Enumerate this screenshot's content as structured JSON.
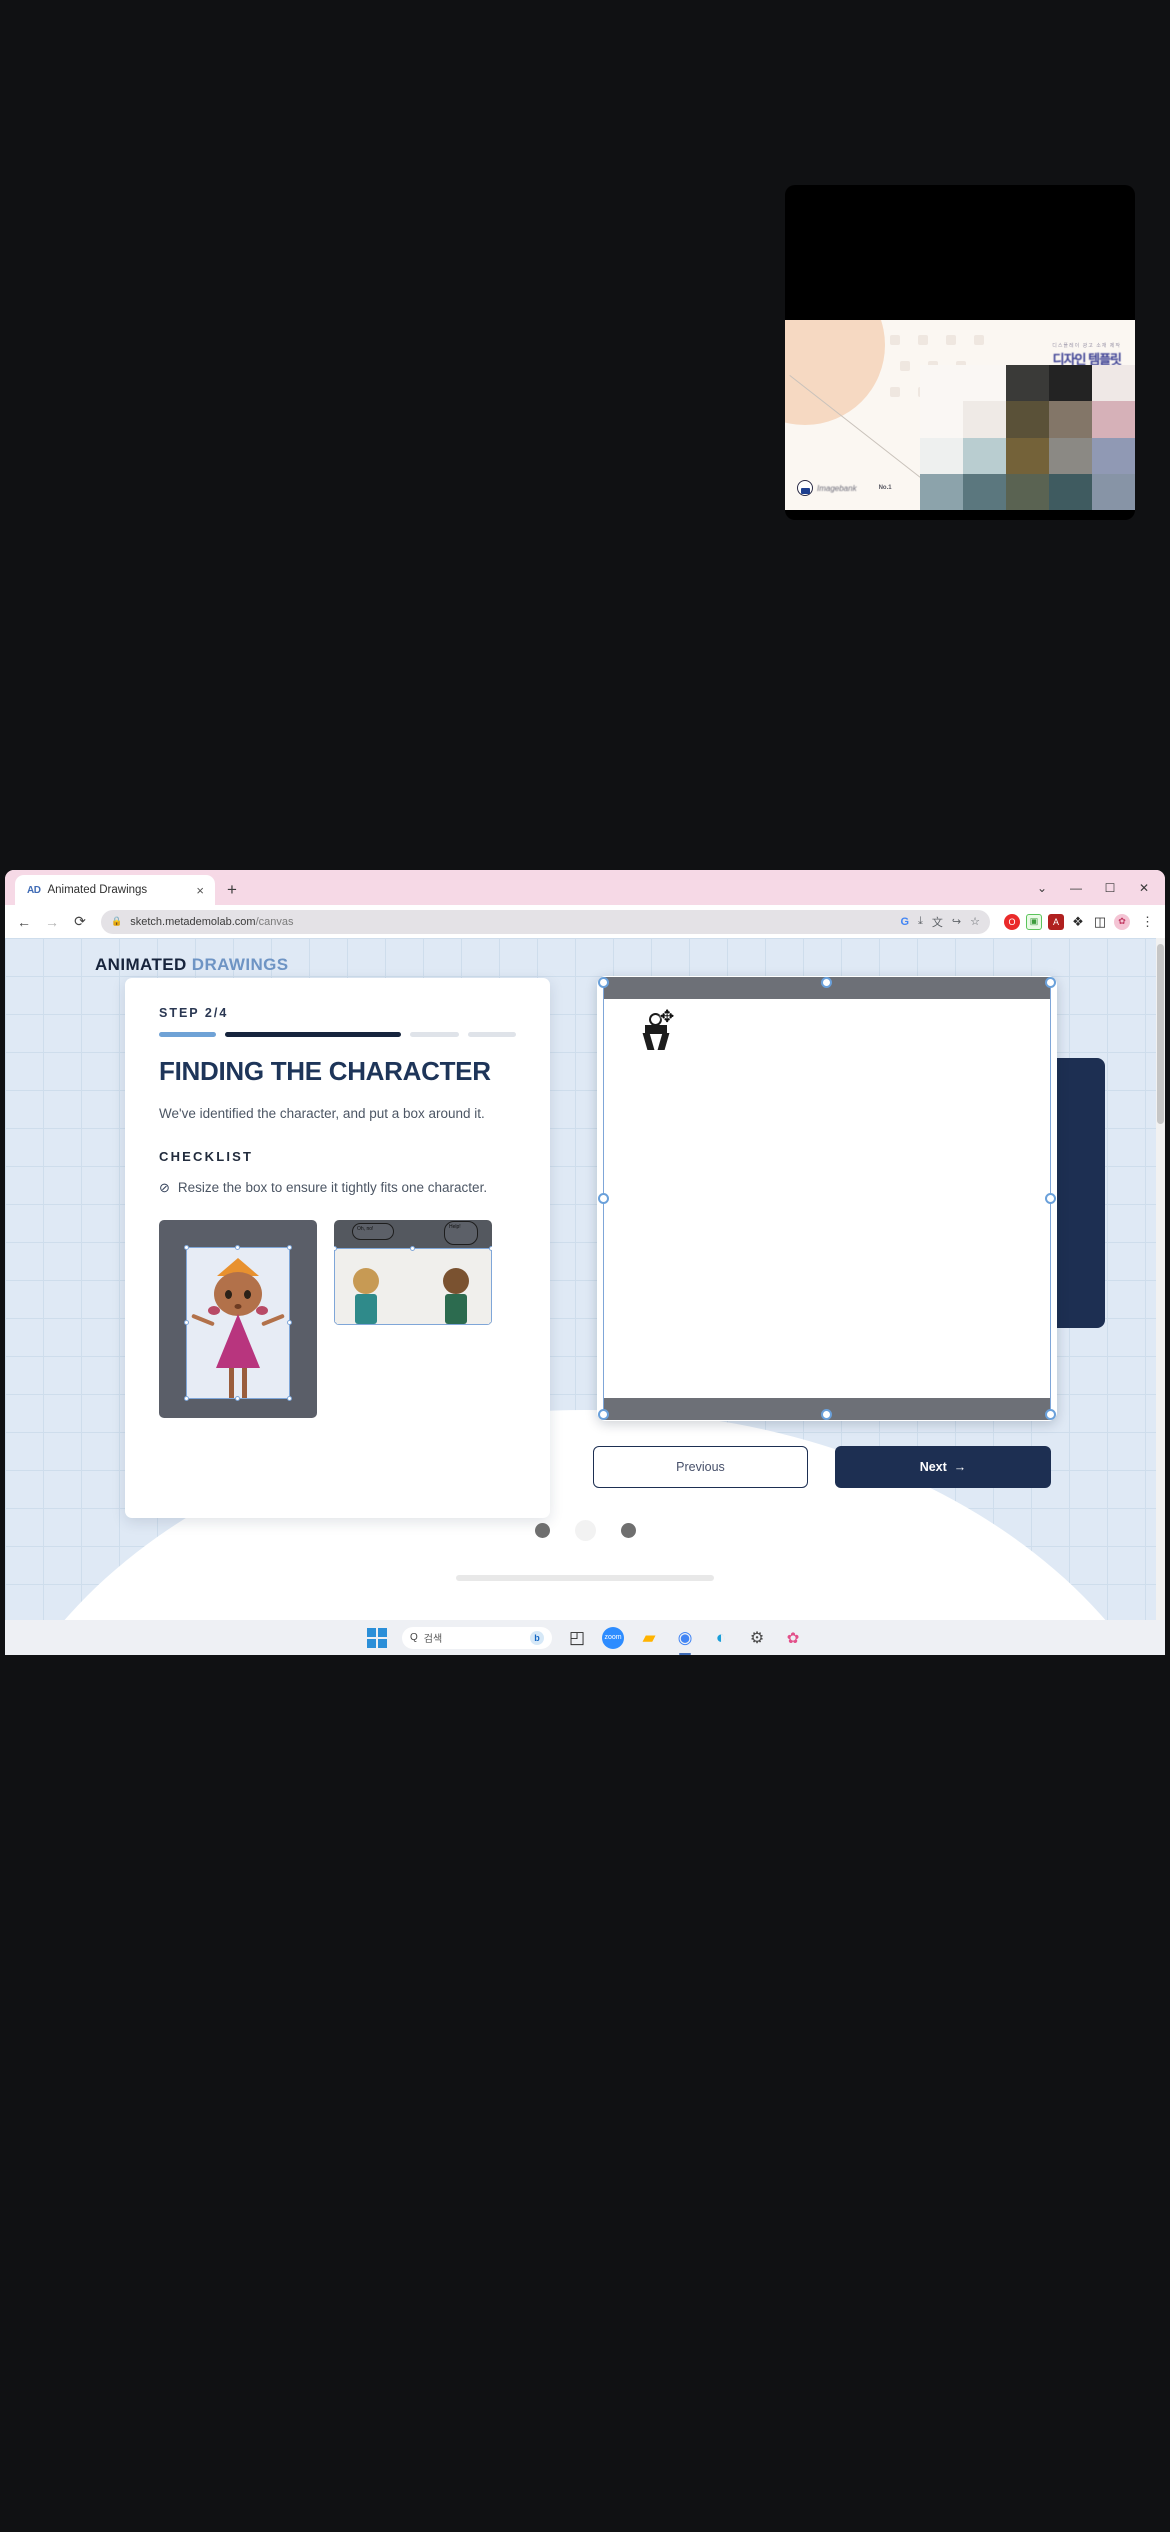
{
  "preview_card": {
    "heading_sub": "디스플레이 광고 소재 제작",
    "heading_title": "디자인 템플릿",
    "logo_word": "Imagebank",
    "logo_tail": "No.1"
  },
  "browser": {
    "tab": {
      "favicon_text": "AD",
      "title": "Animated Drawings",
      "close_label": "×"
    },
    "new_tab_label": "+",
    "window_controls": [
      {
        "name": "tab-search",
        "glyph": "⌄"
      },
      {
        "name": "minimize",
        "glyph": "—"
      },
      {
        "name": "maximize",
        "glyph": "☐"
      },
      {
        "name": "close",
        "glyph": "✕"
      }
    ],
    "nav": {
      "back": "←",
      "forward": "→",
      "reload": "⟳"
    },
    "omnibox": {
      "lock_icon": "🔒",
      "url_host": "sketch.metademolab.com",
      "url_path": "/canvas",
      "actions": [
        {
          "name": "google-search-icon",
          "glyph": "G",
          "color": "#4285f4"
        },
        {
          "name": "install-app-icon",
          "glyph": "⤓"
        },
        {
          "name": "translate-icon",
          "glyph": "文"
        },
        {
          "name": "share-icon",
          "glyph": "↪"
        },
        {
          "name": "bookmark-star-icon",
          "glyph": "☆"
        }
      ]
    },
    "extensions": [
      {
        "name": "opera-extension-icon",
        "glyph": "O",
        "bg": "#ea2a2a",
        "fg": "#ffffff"
      },
      {
        "name": "screen-capture-extension-icon",
        "glyph": "▣",
        "bg": "#5bc45b",
        "fg": "#ffffff"
      },
      {
        "name": "adobe-acrobat-extension-icon",
        "glyph": "A",
        "bg": "#b0201f",
        "fg": "#ffffff"
      },
      {
        "name": "puzzle-extensions-icon",
        "glyph": "❖",
        "bg": "#ffffff",
        "fg": "#2b2b2b"
      },
      {
        "name": "side-panel-icon",
        "glyph": "◫",
        "bg": "#ffffff",
        "fg": "#2b2b2b"
      },
      {
        "name": "profile-avatar-icon",
        "glyph": "✿",
        "bg": "#f4c4d4",
        "fg": "#c23b63"
      }
    ],
    "menu_dots": "⋮"
  },
  "page": {
    "brand": {
      "part1": "ANIMATED",
      "part2": "DRAWINGS"
    },
    "step_card": {
      "step_label": "STEP 2/4",
      "progress": {
        "current": 2,
        "total": 4
      },
      "title": "FINDING THE CHARACTER",
      "description": "We've identified the character, and put a box around it.",
      "checklist_heading": "CHECKLIST",
      "checklist": [
        {
          "mark": "⊘",
          "text": "Resize the box to ensure it tightly fits one character."
        }
      ],
      "thumbnails": [
        {
          "name": "thumbnail-princess-example",
          "caption": ""
        },
        {
          "name": "thumbnail-two-characters-example",
          "bubble_left": "Oh, no!",
          "bubble_right": "Help!"
        }
      ]
    },
    "canvas": {
      "cursor_icon": "✥",
      "figure_name": "sketched-character"
    },
    "buttons": {
      "previous": "Previous",
      "next": "Next",
      "next_arrow": "→"
    }
  },
  "taskbar": {
    "search_placeholder": "검색",
    "search_icon": "Q",
    "bing_icon": "b",
    "items": [
      {
        "name": "task-view-icon",
        "glyph": "◰",
        "color": "#2b2b2b"
      },
      {
        "name": "zoom-icon",
        "glyph": "■",
        "color": "#2d8cff"
      },
      {
        "name": "file-explorer-icon",
        "glyph": "▰",
        "color": "#ffb300"
      },
      {
        "name": "chrome-icon",
        "glyph": "◉",
        "color": "#4285f4",
        "active": true
      },
      {
        "name": "edge-icon",
        "glyph": "◐",
        "color": "#1a9ed9"
      },
      {
        "name": "settings-gear-icon",
        "glyph": "⚙",
        "color": "#4a4a4a"
      },
      {
        "name": "paint-icon",
        "glyph": "✿",
        "color": "#e2508a"
      }
    ]
  },
  "device_nav": {
    "recents": "●",
    "home": "●",
    "back": "●"
  }
}
